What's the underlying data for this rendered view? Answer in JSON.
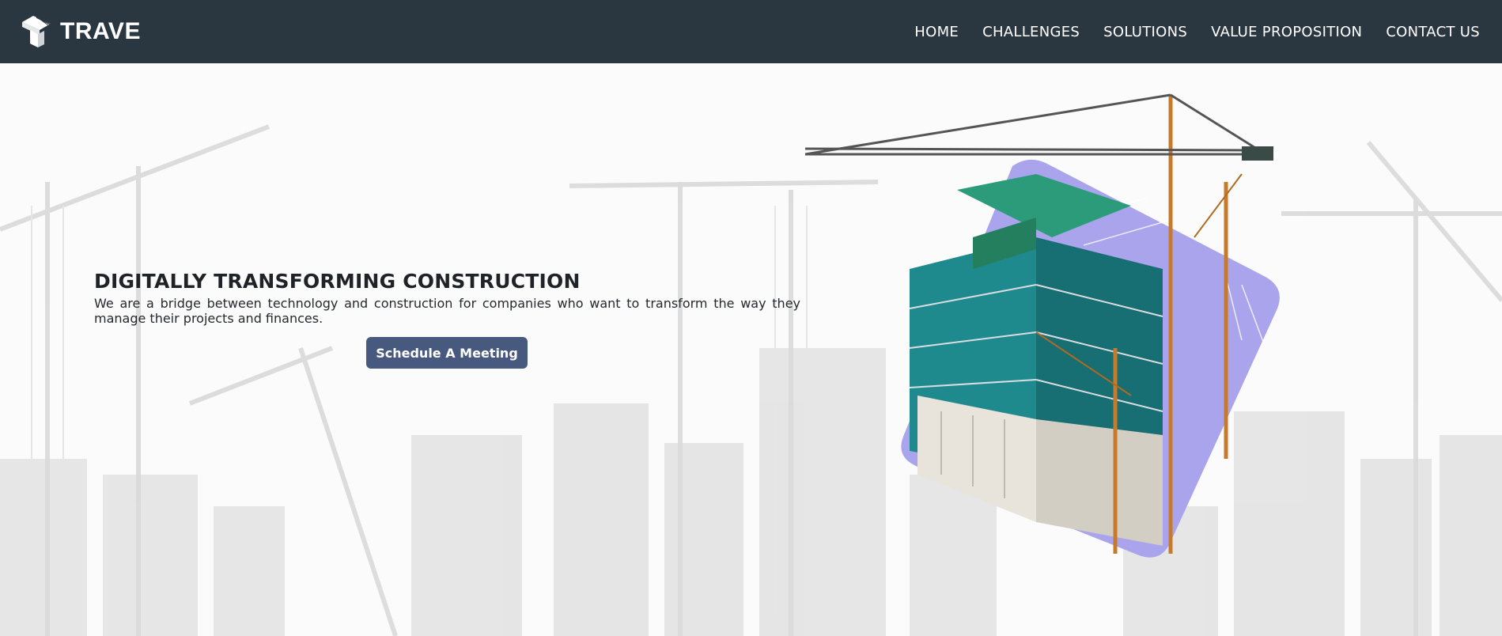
{
  "brand": {
    "name": "TRAVE",
    "logo_icon": "trave-logo-icon"
  },
  "nav": {
    "items": [
      {
        "label": "HOME"
      },
      {
        "label": "CHALLENGES"
      },
      {
        "label": "SOLUTIONS"
      },
      {
        "label": "VALUE PROPOSITION"
      },
      {
        "label": "CONTACT US"
      }
    ]
  },
  "hero": {
    "title": "DIGITALLY TRANSFORMING CONSTRUCTION",
    "description": "We are a bridge between technology and construction for companies who want to transform the way they manage their projects and finances.",
    "cta_label": "Schedule A Meeting",
    "image_icon": "construction-building-image",
    "background_icon": "construction-skyline-background"
  },
  "colors": {
    "header_bg": "#2b3740",
    "cta_bg": "#48597f",
    "accent_purple": "#a9a4ec",
    "building_teal": "#1f8a8c",
    "crane_orange": "#c77a2a"
  }
}
